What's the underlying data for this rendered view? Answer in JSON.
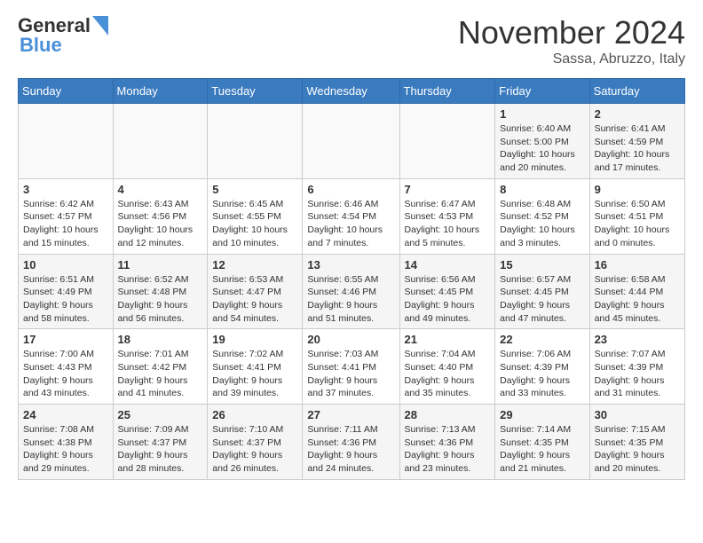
{
  "header": {
    "logo_general": "General",
    "logo_blue": "Blue",
    "title": "November 2024",
    "subtitle": "Sassa, Abruzzo, Italy"
  },
  "calendar": {
    "weekdays": [
      "Sunday",
      "Monday",
      "Tuesday",
      "Wednesday",
      "Thursday",
      "Friday",
      "Saturday"
    ],
    "weeks": [
      [
        {
          "day": "",
          "info": ""
        },
        {
          "day": "",
          "info": ""
        },
        {
          "day": "",
          "info": ""
        },
        {
          "day": "",
          "info": ""
        },
        {
          "day": "",
          "info": ""
        },
        {
          "day": "1",
          "info": "Sunrise: 6:40 AM\nSunset: 5:00 PM\nDaylight: 10 hours\nand 20 minutes."
        },
        {
          "day": "2",
          "info": "Sunrise: 6:41 AM\nSunset: 4:59 PM\nDaylight: 10 hours\nand 17 minutes."
        }
      ],
      [
        {
          "day": "3",
          "info": "Sunrise: 6:42 AM\nSunset: 4:57 PM\nDaylight: 10 hours\nand 15 minutes."
        },
        {
          "day": "4",
          "info": "Sunrise: 6:43 AM\nSunset: 4:56 PM\nDaylight: 10 hours\nand 12 minutes."
        },
        {
          "day": "5",
          "info": "Sunrise: 6:45 AM\nSunset: 4:55 PM\nDaylight: 10 hours\nand 10 minutes."
        },
        {
          "day": "6",
          "info": "Sunrise: 6:46 AM\nSunset: 4:54 PM\nDaylight: 10 hours\nand 7 minutes."
        },
        {
          "day": "7",
          "info": "Sunrise: 6:47 AM\nSunset: 4:53 PM\nDaylight: 10 hours\nand 5 minutes."
        },
        {
          "day": "8",
          "info": "Sunrise: 6:48 AM\nSunset: 4:52 PM\nDaylight: 10 hours\nand 3 minutes."
        },
        {
          "day": "9",
          "info": "Sunrise: 6:50 AM\nSunset: 4:51 PM\nDaylight: 10 hours\nand 0 minutes."
        }
      ],
      [
        {
          "day": "10",
          "info": "Sunrise: 6:51 AM\nSunset: 4:49 PM\nDaylight: 9 hours\nand 58 minutes."
        },
        {
          "day": "11",
          "info": "Sunrise: 6:52 AM\nSunset: 4:48 PM\nDaylight: 9 hours\nand 56 minutes."
        },
        {
          "day": "12",
          "info": "Sunrise: 6:53 AM\nSunset: 4:47 PM\nDaylight: 9 hours\nand 54 minutes."
        },
        {
          "day": "13",
          "info": "Sunrise: 6:55 AM\nSunset: 4:46 PM\nDaylight: 9 hours\nand 51 minutes."
        },
        {
          "day": "14",
          "info": "Sunrise: 6:56 AM\nSunset: 4:45 PM\nDaylight: 9 hours\nand 49 minutes."
        },
        {
          "day": "15",
          "info": "Sunrise: 6:57 AM\nSunset: 4:45 PM\nDaylight: 9 hours\nand 47 minutes."
        },
        {
          "day": "16",
          "info": "Sunrise: 6:58 AM\nSunset: 4:44 PM\nDaylight: 9 hours\nand 45 minutes."
        }
      ],
      [
        {
          "day": "17",
          "info": "Sunrise: 7:00 AM\nSunset: 4:43 PM\nDaylight: 9 hours\nand 43 minutes."
        },
        {
          "day": "18",
          "info": "Sunrise: 7:01 AM\nSunset: 4:42 PM\nDaylight: 9 hours\nand 41 minutes."
        },
        {
          "day": "19",
          "info": "Sunrise: 7:02 AM\nSunset: 4:41 PM\nDaylight: 9 hours\nand 39 minutes."
        },
        {
          "day": "20",
          "info": "Sunrise: 7:03 AM\nSunset: 4:41 PM\nDaylight: 9 hours\nand 37 minutes."
        },
        {
          "day": "21",
          "info": "Sunrise: 7:04 AM\nSunset: 4:40 PM\nDaylight: 9 hours\nand 35 minutes."
        },
        {
          "day": "22",
          "info": "Sunrise: 7:06 AM\nSunset: 4:39 PM\nDaylight: 9 hours\nand 33 minutes."
        },
        {
          "day": "23",
          "info": "Sunrise: 7:07 AM\nSunset: 4:39 PM\nDaylight: 9 hours\nand 31 minutes."
        }
      ],
      [
        {
          "day": "24",
          "info": "Sunrise: 7:08 AM\nSunset: 4:38 PM\nDaylight: 9 hours\nand 29 minutes."
        },
        {
          "day": "25",
          "info": "Sunrise: 7:09 AM\nSunset: 4:37 PM\nDaylight: 9 hours\nand 28 minutes."
        },
        {
          "day": "26",
          "info": "Sunrise: 7:10 AM\nSunset: 4:37 PM\nDaylight: 9 hours\nand 26 minutes."
        },
        {
          "day": "27",
          "info": "Sunrise: 7:11 AM\nSunset: 4:36 PM\nDaylight: 9 hours\nand 24 minutes."
        },
        {
          "day": "28",
          "info": "Sunrise: 7:13 AM\nSunset: 4:36 PM\nDaylight: 9 hours\nand 23 minutes."
        },
        {
          "day": "29",
          "info": "Sunrise: 7:14 AM\nSunset: 4:35 PM\nDaylight: 9 hours\nand 21 minutes."
        },
        {
          "day": "30",
          "info": "Sunrise: 7:15 AM\nSunset: 4:35 PM\nDaylight: 9 hours\nand 20 minutes."
        }
      ]
    ]
  }
}
